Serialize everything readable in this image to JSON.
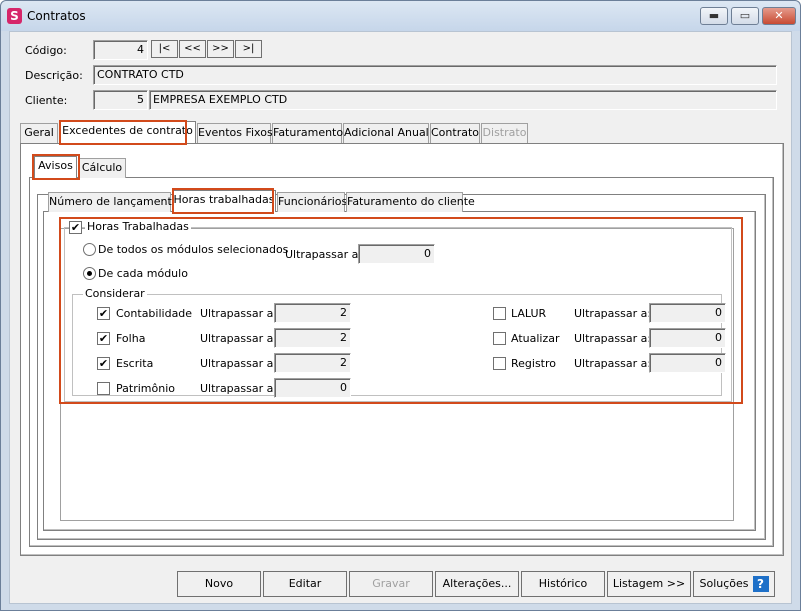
{
  "window": {
    "title": "Contratos",
    "icon": "S",
    "minimize": "▬",
    "maximize": "▭",
    "close": "✕"
  },
  "header": {
    "codigo_label": "Código:",
    "codigo_value": "4",
    "nav": [
      "|<",
      "<<",
      ">>",
      ">|"
    ],
    "descricao_label": "Descrição:",
    "descricao_value": "CONTRATO CTD",
    "cliente_label": "Cliente:",
    "cliente_code": "5",
    "cliente_name": "EMPRESA EXEMPLO CTD"
  },
  "main_tabs": [
    "Geral",
    "Excedentes de contrato",
    "Eventos Fixos",
    "Faturamento",
    "Adicional Anual",
    "Contrato",
    "Distrato"
  ],
  "sub_tabs": [
    "Avisos",
    "Cálculo"
  ],
  "inner_tabs": [
    "Número de lançamentos",
    "Horas trabalhadas",
    "Funcionários",
    "Faturamento do cliente"
  ],
  "horas": {
    "enabled_label": "Horas Trabalhadas",
    "radio_todos": "De todos os módulos selecionados",
    "radio_cada": "De cada módulo",
    "ultrapassar_label": "Ultrapassar a:",
    "ultrapassar_value": "0",
    "considerar_title": "Considerar",
    "left_modules": [
      {
        "name": "Contabilidade",
        "checked": true,
        "value": "2"
      },
      {
        "name": "Folha",
        "checked": true,
        "value": "2"
      },
      {
        "name": "Escrita",
        "checked": true,
        "value": "2"
      },
      {
        "name": "Patrimônio",
        "checked": false,
        "value": "0"
      }
    ],
    "right_modules": [
      {
        "name": "LALUR",
        "checked": false,
        "value": "0"
      },
      {
        "name": "Atualizar",
        "checked": false,
        "value": "0"
      },
      {
        "name": "Registro",
        "checked": false,
        "value": "0"
      }
    ]
  },
  "buttons": {
    "novo": "Novo",
    "editar": "Editar",
    "gravar": "Gravar",
    "alteracoes": "Alterações...",
    "historico": "Histórico",
    "listagem": "Listagem >>",
    "solucoes": "Soluções",
    "help": "?"
  },
  "check_mark": "✔",
  "colors": {
    "highlight": "#d24a1b",
    "title_bar": "#cfdbe9",
    "app_icon": "#d6266a"
  }
}
